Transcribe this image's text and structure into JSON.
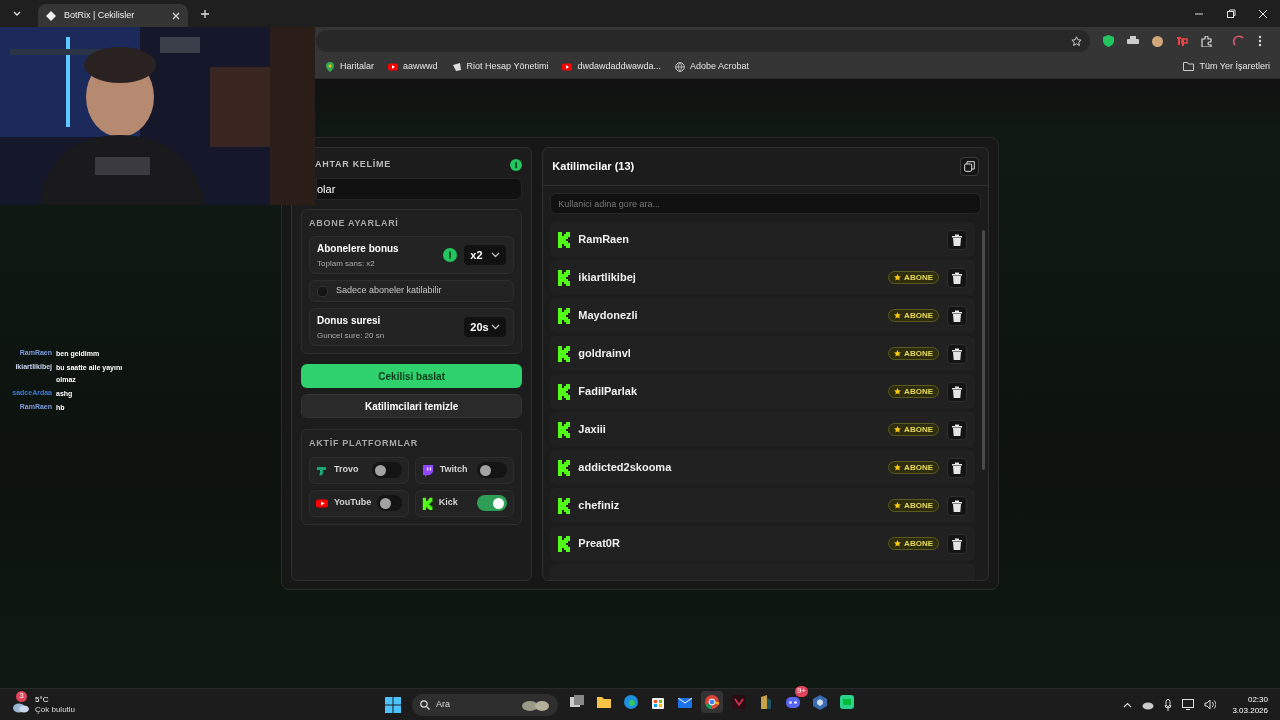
{
  "browser": {
    "tab_title": "BotRix | Cekilisler",
    "bookmarks": [
      {
        "kind": "maps",
        "label": "Haritalar"
      },
      {
        "kind": "youtube",
        "label": "aawwwd"
      },
      {
        "kind": "riot",
        "label": "Riot Hesap Yönetimi"
      },
      {
        "kind": "youtube",
        "label": "dwdawdaddwawda..."
      },
      {
        "kind": "globe",
        "label": "Adobe Acrobat"
      }
    ],
    "all_bookmarks": "Tüm Yer İşaretleri"
  },
  "keyword": {
    "label": "AHTAR KELİME",
    "value": "olar"
  },
  "subscriber_settings": {
    "title": "ABONE AYARLARİ",
    "bonus": {
      "label": "Abonelere bonus",
      "hint": "Toplam sans: x2",
      "value": "x2"
    },
    "subs_only": {
      "label": "Sadece aboneler katilabilir",
      "checked": false
    },
    "duration": {
      "label": "Donus suresi",
      "hint": "Guncel sure: 20 sn",
      "value": "20s"
    }
  },
  "buttons": {
    "start": "Cekilisi baslat",
    "clear": "Katilimcilari temizle"
  },
  "platforms": {
    "title": "AKTİF PLATFORMLAR",
    "items": [
      {
        "kind": "trovo",
        "label": "Trovo",
        "on": false
      },
      {
        "kind": "twitch",
        "label": "Twitch",
        "on": false
      },
      {
        "kind": "youtube",
        "label": "YouTube",
        "on": false
      },
      {
        "kind": "kick",
        "label": "Kick",
        "on": true
      }
    ]
  },
  "participants": {
    "title": "Katilimcilar (13)",
    "search_placeholder": "Kullanici adina gore ara...",
    "rows": [
      {
        "name": "RamRaen"
      },
      {
        "name": "ikiartlikibej",
        "badge": "ABONE"
      },
      {
        "name": "Maydonezli",
        "badge": "ABONE"
      },
      {
        "name": "goldrainvl",
        "badge": "ABONE"
      },
      {
        "name": "FadilParlak",
        "badge": "ABONE"
      },
      {
        "name": "Jaxiii",
        "badge": "ABONE"
      },
      {
        "name": "addicted2skooma",
        "badge": "ABONE"
      },
      {
        "name": "chefiniz",
        "badge": "ABONE"
      },
      {
        "name": "Preat0R",
        "badge": "ABONE"
      }
    ]
  },
  "chat": [
    {
      "user": "RamRaen",
      "color": "#7b9be0",
      "text": "ben geldimm"
    },
    {
      "user": "ikiartlikibej",
      "color": "#c8d4f0",
      "text": "bu saatte aile yayını olmaz"
    },
    {
      "user": "sadceArdaa",
      "color": "#3f78d8",
      "text": "ashg"
    },
    {
      "user": "RamRaen",
      "color": "#7b9be0",
      "text": "hb"
    }
  ],
  "taskbar": {
    "weather_badge": "3",
    "weather_temp": "5°C",
    "weather_text": "Çok bulutlu",
    "search": "Ara",
    "discord_badge": "9+",
    "time": "02:30",
    "date": "3.03.2026"
  }
}
